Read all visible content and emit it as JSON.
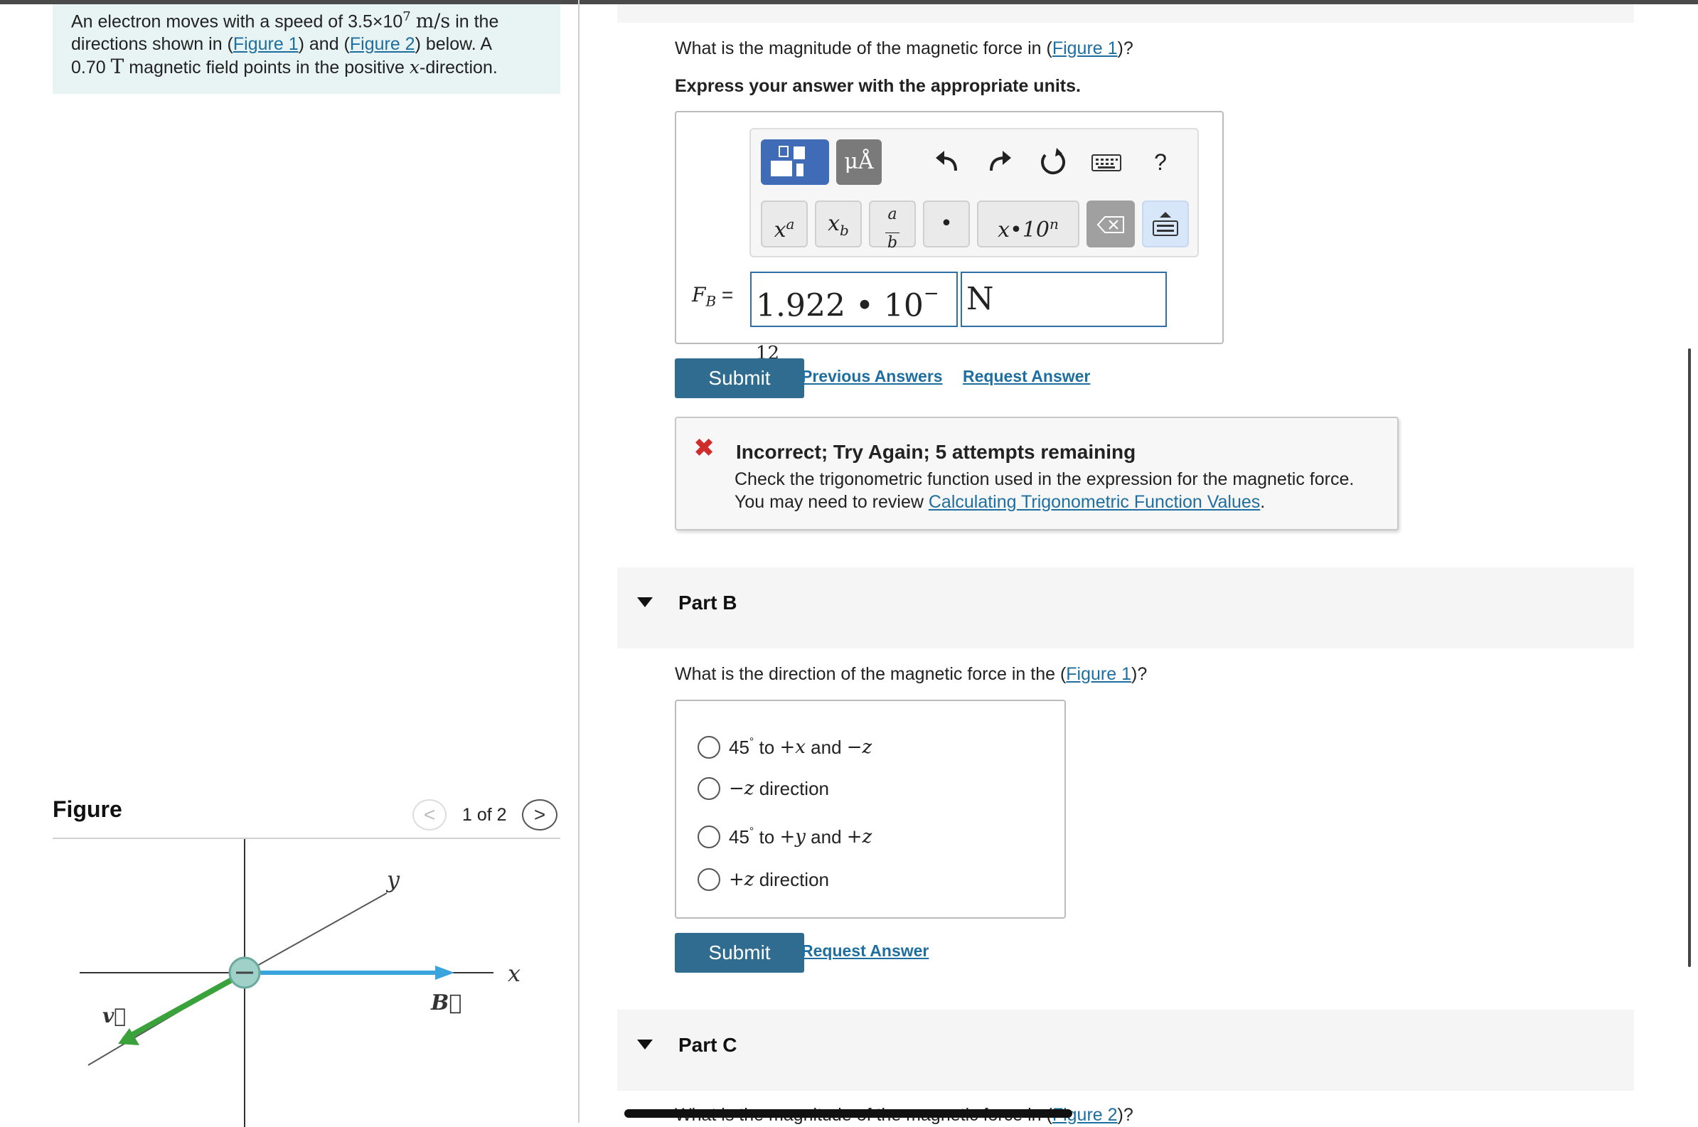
{
  "problem": {
    "text_a": "An electron moves with a speed of ",
    "speed_value": "3.5×10",
    "speed_exp": "7",
    "speed_unit": "m/s",
    "text_b": " in the",
    "text_c": "directions shown in (",
    "fig1_link": "Figure 1",
    "text_d": ") and (",
    "fig2_link": "Figure 2",
    "text_e": ") below. A",
    "field_value": "0.70 ",
    "field_unit": "T",
    "text_f": " magnetic field points in the positive ",
    "axis_x": "x",
    "text_g": "-direction."
  },
  "figure_panel": {
    "title": "Figure",
    "pager": "1 of 2",
    "prev": "<",
    "next": ">",
    "labels": {
      "y": "y",
      "x": "x",
      "B": "B⃗",
      "v": "v⃗"
    },
    "colors": {
      "velocity": "#3aa23a",
      "field": "#3aa4dd",
      "electron": "#9fd1c8"
    }
  },
  "part_a": {
    "question_pre": "What is the magnitude of the magnetic force in (",
    "question_link": "Figure 1",
    "question_post": ")?",
    "instruction": "Express your answer with the appropriate units.",
    "toolbar": {
      "units": "μÅ",
      "undo_icon": "undo-icon",
      "redo_icon": "redo-icon",
      "reset_icon": "reset-icon",
      "keyboard_icon": "keyboard-icon",
      "help": "?",
      "keys": {
        "superscript": "xᵃ",
        "subscript": "xb",
        "fraction": "a/b",
        "dot": "•",
        "sci": "x•10ⁿ"
      }
    },
    "label": "F",
    "label_sub": "B",
    "equals": "=",
    "answer_value": "1.922 • 10",
    "answer_exp": "− 12",
    "answer_unit": "N",
    "submit": "Submit",
    "previous_answers": "Previous Answers",
    "request_answer": "Request Answer",
    "feedback": {
      "title": "Incorrect; Try Again; 5 attempts remaining",
      "line1": "Check the trigonometric function used in the expression for the magnetic force.",
      "line2_pre": "You may need to review ",
      "line2_link": "Calculating Trigonometric Function Values",
      "line2_post": "."
    }
  },
  "part_b": {
    "label": "Part B",
    "question_pre": "What is the direction of the magnetic force in the (",
    "question_link": "Figure 1",
    "question_post": ")?",
    "options": [
      {
        "a": "45",
        "b": "°",
        "c": " to ",
        "d": "+x",
        "e": " and ",
        "f": "−z"
      },
      {
        "a": "−z",
        "b": " direction"
      },
      {
        "a": "45",
        "b": "°",
        "c": " to ",
        "d": "+y",
        "e": " and ",
        "f": "+z"
      },
      {
        "a": "+z",
        "b": " direction"
      }
    ],
    "submit": "Submit",
    "request_answer": "Request Answer"
  },
  "part_c": {
    "label": "Part C",
    "question_pre": "What is the magnitude of the magnetic force in (",
    "question_link": "Figure 2",
    "question_post": ")?"
  }
}
